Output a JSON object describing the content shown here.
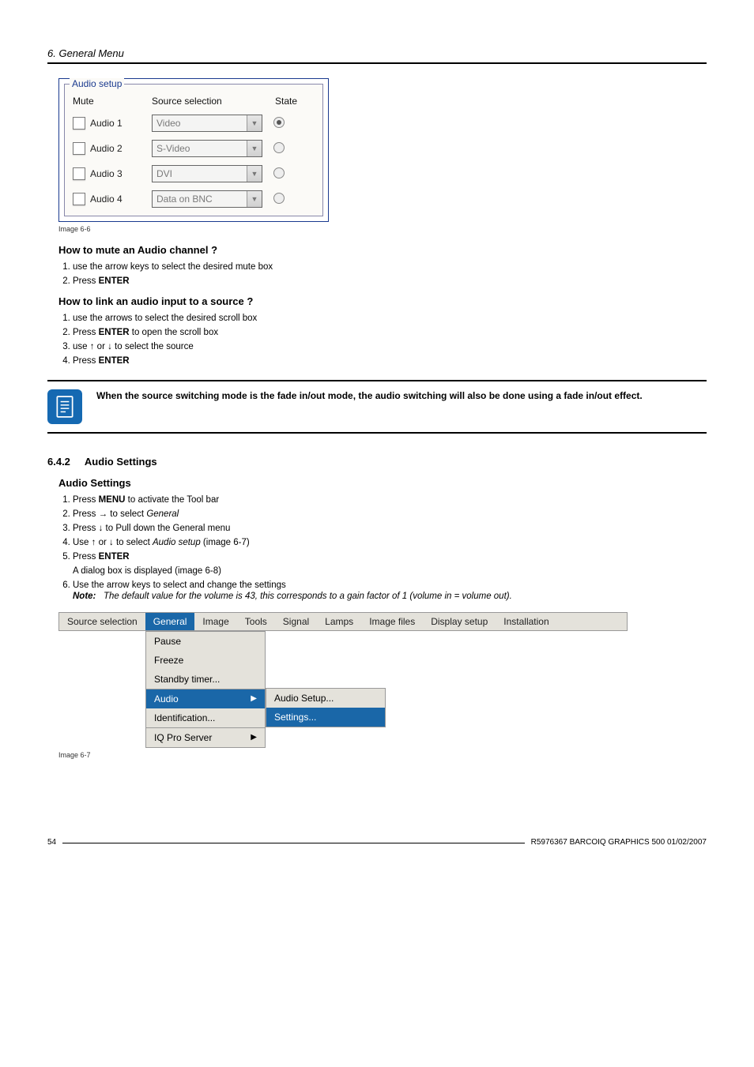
{
  "header": {
    "breadcrumb": "6.  General Menu"
  },
  "audio_setup": {
    "title": "Audio setup",
    "col_mute": "Mute",
    "col_source": "Source selection",
    "col_state": "State",
    "rows": [
      {
        "label": "Audio 1",
        "source": "Video",
        "selected": true
      },
      {
        "label": "Audio 2",
        "source": "S-Video",
        "selected": false
      },
      {
        "label": "Audio 3",
        "source": "DVI",
        "selected": false
      },
      {
        "label": "Audio 4",
        "source": "Data on BNC",
        "selected": false
      }
    ],
    "caption": "Image 6-6"
  },
  "howto_mute": {
    "title": "How to mute an Audio channel ?",
    "s1a": "use the arrow keys to select the desired mute box",
    "s2a": "Press ",
    "s2b": "ENTER"
  },
  "howto_link": {
    "title": "How to link an audio input to a source ?",
    "s1": "use the arrows to select the desired scroll box",
    "s2a": "Press ",
    "s2b": "ENTER",
    "s2c": " to open the scroll box",
    "s3": "use ↑ or ↓ to select the source",
    "s4a": "Press ",
    "s4b": "ENTER"
  },
  "note": {
    "text": "When the source switching mode is the fade in/out mode, the audio switching will also be done using a fade in/out effect."
  },
  "section": {
    "num": "6.4.2",
    "title": "Audio Settings"
  },
  "audio_settings": {
    "title": "Audio Settings",
    "s1a": "Press ",
    "s1b": "MENU",
    "s1c": " to activate the Tool bar",
    "s2a": "Press → to select ",
    "s2b": "General",
    "s3": "Press ↓ to Pull down the General menu",
    "s4a": "Use ↑ or ↓ to select ",
    "s4b": "Audio setup",
    "s4c": " (image 6-7)",
    "s5a": "Press ",
    "s5b": "ENTER",
    "s5sub": "A dialog box is displayed (image 6-8)",
    "s6": "Use the arrow keys to select and change the settings",
    "s6note_label": "Note:",
    "s6note_text": "The default value for the volume is 43, this corresponds to a gain factor of 1 (volume in = volume out)."
  },
  "menubar": {
    "items": [
      "Source selection",
      "General",
      "Image",
      "Tools",
      "Signal",
      "Lamps",
      "Image files",
      "Display setup",
      "Installation"
    ],
    "dropdown": [
      "Pause",
      "Freeze",
      "Standby timer...",
      "Audio",
      "Identification...",
      "IQ Pro Server"
    ],
    "submenu": [
      "Audio Setup...",
      "Settings..."
    ],
    "caption": "Image 6-7"
  },
  "footer": {
    "page": "54",
    "doc": "R5976367  BARCOIQ GRAPHICS 500  01/02/2007"
  }
}
